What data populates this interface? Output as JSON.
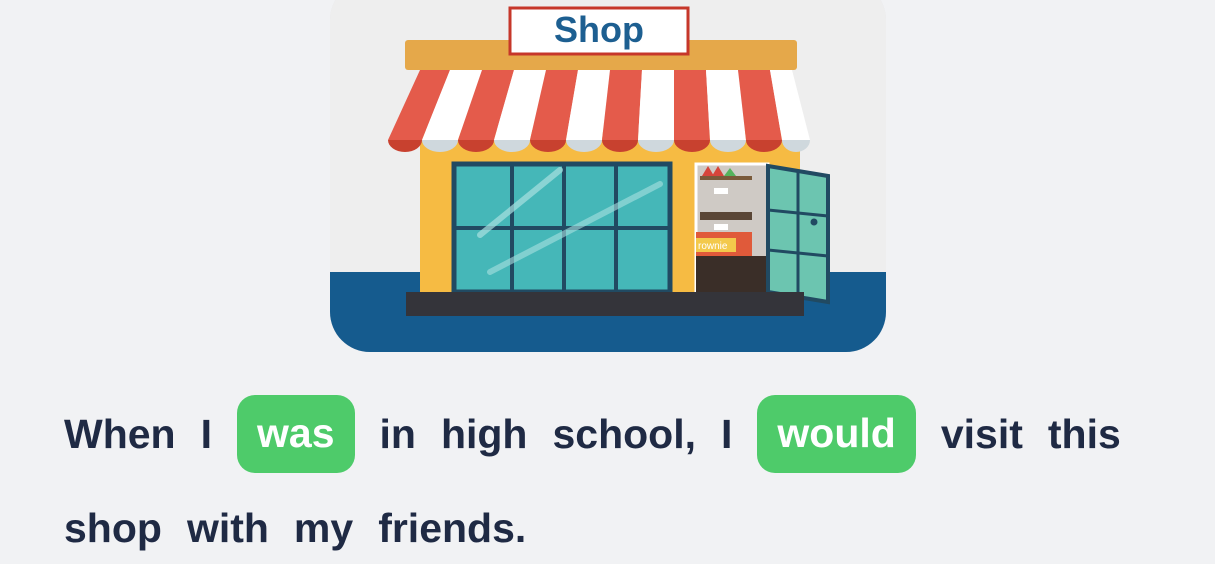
{
  "illustration": {
    "sign_text": "Shop",
    "brownie_label": "rownie",
    "colors": {
      "ground": "#155b8e",
      "awning_red": "#e45b4b",
      "awning_white": "#ffffff",
      "wall": "#f6bb43",
      "roof_trim": "#e5a84a",
      "glass": "#45b7b8",
      "frame": "#214a62",
      "sign_border": "#c6372a",
      "sign_text": "#1d5f91"
    }
  },
  "sentence": {
    "w1": "When",
    "w2": "I",
    "blank1": "was",
    "w3": "in",
    "w4": "high",
    "w5": "school,",
    "w6": "I",
    "blank2": "would",
    "w7": "visit",
    "w8": "this",
    "w9": "shop",
    "w10": "with",
    "w11": "my",
    "w12": "friends."
  },
  "chip_color": "#4ecb6a"
}
